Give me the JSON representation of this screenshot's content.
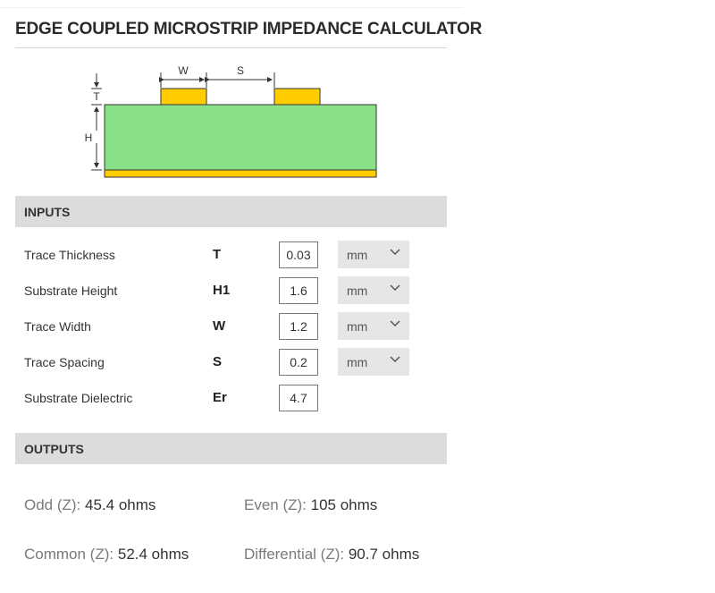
{
  "title": "EDGE COUPLED MICROSTRIP IMPEDANCE CALCULATOR",
  "diagram": {
    "labels": {
      "w": "W",
      "s": "S",
      "t": "T",
      "h": "H"
    },
    "colors": {
      "substrate": "#88e088",
      "copper": "#ffcc00",
      "outline": "#333333"
    }
  },
  "inputs": {
    "header": "INPUTS",
    "rows": [
      {
        "label": "Trace Thickness",
        "symbol": "T",
        "value": "0.03",
        "unit": "mm"
      },
      {
        "label": "Substrate Height",
        "symbol": "H1",
        "value": "1.6",
        "unit": "mm"
      },
      {
        "label": "Trace Width",
        "symbol": "W",
        "value": "1.2",
        "unit": "mm"
      },
      {
        "label": "Trace Spacing",
        "symbol": "S",
        "value": "0.2",
        "unit": "mm"
      },
      {
        "label": "Substrate Dielectric",
        "symbol": "Er",
        "value": "4.7"
      }
    ]
  },
  "outputs": {
    "header": "OUTPUTS",
    "odd": {
      "label": "Odd (Z):",
      "value": "45.4 ohms"
    },
    "even": {
      "label": "Even (Z):",
      "value": "105 ohms"
    },
    "common": {
      "label": "Common (Z):",
      "value": "52.4 ohms"
    },
    "differential": {
      "label": "Differential (Z):",
      "value": "90.7 ohms"
    }
  },
  "icons": {
    "select_chevron": "chevron-down-icon"
  }
}
